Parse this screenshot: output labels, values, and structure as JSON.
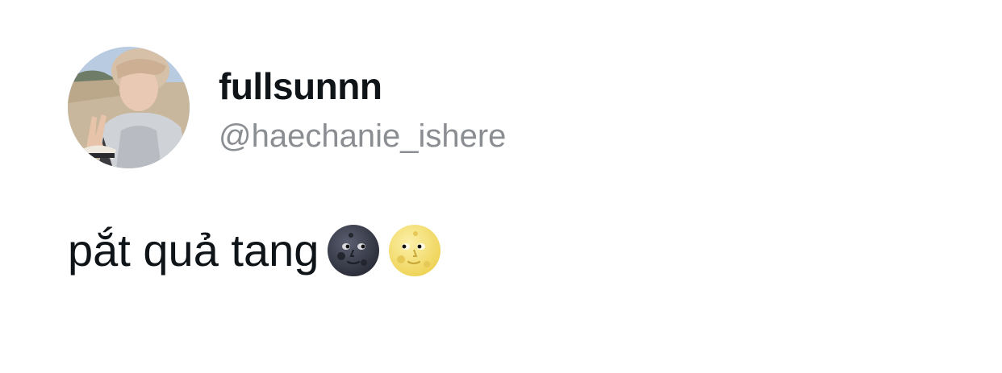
{
  "user": {
    "display_name": "fullsunnn",
    "handle": "@haechanie_ishere",
    "avatar_icon": "profile-photo"
  },
  "tweet": {
    "text": "pắt quả tang",
    "emojis": [
      "new-moon-face-icon",
      "full-moon-face-icon"
    ]
  },
  "colors": {
    "name": "#0f1419",
    "handle": "#8a8d91",
    "background": "#ffffff",
    "new_moon": "#3a3d4a",
    "full_moon": "#f7e27a"
  }
}
